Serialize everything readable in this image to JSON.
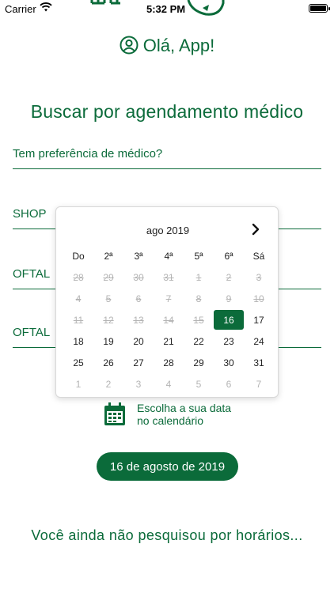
{
  "status_bar": {
    "carrier": "Carrier",
    "time": "5:32 PM"
  },
  "greeting": {
    "text": "Olá, App!"
  },
  "search": {
    "title": "Buscar por agendamento médico",
    "fields": [
      {
        "value": "Tem preferência de médico?"
      },
      {
        "value": "SHOP"
      },
      {
        "value": "OFTAL"
      },
      {
        "value": "OFTAL"
      }
    ]
  },
  "calendar": {
    "month_label": "ago 2019",
    "weekdays": [
      "Do",
      "2ª",
      "3ª",
      "4ª",
      "5ª",
      "6ª",
      "Sá"
    ],
    "days": [
      {
        "label": "28",
        "state": "disabled"
      },
      {
        "label": "29",
        "state": "disabled"
      },
      {
        "label": "30",
        "state": "disabled"
      },
      {
        "label": "31",
        "state": "disabled"
      },
      {
        "label": "1",
        "state": "disabled"
      },
      {
        "label": "2",
        "state": "disabled"
      },
      {
        "label": "3",
        "state": "disabled"
      },
      {
        "label": "4",
        "state": "disabled"
      },
      {
        "label": "5",
        "state": "disabled"
      },
      {
        "label": "6",
        "state": "disabled"
      },
      {
        "label": "7",
        "state": "disabled"
      },
      {
        "label": "8",
        "state": "disabled"
      },
      {
        "label": "9",
        "state": "disabled"
      },
      {
        "label": "10",
        "state": "disabled"
      },
      {
        "label": "11",
        "state": "disabled"
      },
      {
        "label": "12",
        "state": "disabled"
      },
      {
        "label": "13",
        "state": "disabled"
      },
      {
        "label": "14",
        "state": "disabled"
      },
      {
        "label": "15",
        "state": "disabled"
      },
      {
        "label": "16",
        "state": "selected"
      },
      {
        "label": "17",
        "state": "enabled"
      },
      {
        "label": "18",
        "state": "enabled"
      },
      {
        "label": "19",
        "state": "enabled"
      },
      {
        "label": "20",
        "state": "enabled"
      },
      {
        "label": "21",
        "state": "enabled"
      },
      {
        "label": "22",
        "state": "enabled"
      },
      {
        "label": "23",
        "state": "enabled"
      },
      {
        "label": "24",
        "state": "enabled"
      },
      {
        "label": "25",
        "state": "enabled"
      },
      {
        "label": "26",
        "state": "enabled"
      },
      {
        "label": "27",
        "state": "enabled"
      },
      {
        "label": "28",
        "state": "enabled"
      },
      {
        "label": "29",
        "state": "enabled"
      },
      {
        "label": "30",
        "state": "enabled"
      },
      {
        "label": "31",
        "state": "enabled"
      },
      {
        "label": "1",
        "state": "outside"
      },
      {
        "label": "2",
        "state": "outside"
      },
      {
        "label": "3",
        "state": "outside"
      },
      {
        "label": "4",
        "state": "outside"
      },
      {
        "label": "5",
        "state": "outside"
      },
      {
        "label": "6",
        "state": "outside"
      },
      {
        "label": "7",
        "state": "outside"
      }
    ]
  },
  "hint": {
    "line1": "Escolha a sua data",
    "line2": "no calendário"
  },
  "date_button": {
    "label": "16 de agosto de 2019"
  },
  "empty_state": {
    "text": "Você ainda não pesquisou por horários..."
  },
  "colors": {
    "brand_green": "#0b6b3a",
    "disabled": "#b4b4b4"
  }
}
